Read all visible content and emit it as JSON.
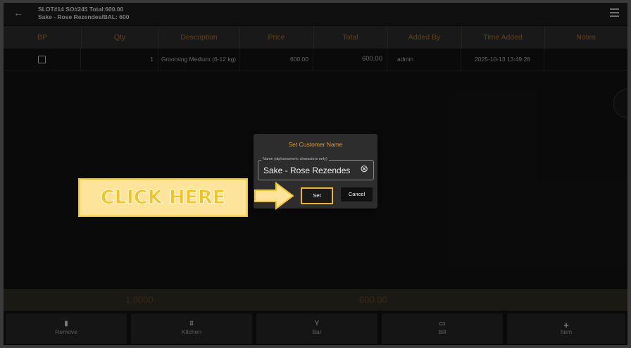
{
  "header": {
    "back_icon": "arrow-left-icon",
    "line1": "SLOT#14 SO#245 Total:600.00",
    "line2": "Sake - Rose Rezendes/BAL: 600",
    "menu_icon": "hamburger-menu-icon"
  },
  "table": {
    "columns": [
      "BP",
      "Qty",
      "Description",
      "Price",
      "Total",
      "Added By",
      "Time Added",
      "Notes"
    ],
    "rows": [
      {
        "bp_checked": false,
        "qty": "1",
        "description": "Grooming Medium (6-12 kg)",
        "price": "600.00",
        "total": "600.00",
        "added_by": "admin",
        "time_added": "2025-10-13 13:49:28",
        "notes": ""
      }
    ]
  },
  "totals": {
    "qty": "1.0000",
    "amount": "600.00"
  },
  "bottom_bar": [
    {
      "label": "Remove",
      "icon": "trash-icon"
    },
    {
      "label": "Kitchen",
      "icon": "chef-icon"
    },
    {
      "label": "Bar",
      "icon": "cocktail-icon"
    },
    {
      "label": "Bill",
      "icon": "receipt-icon"
    },
    {
      "label": "Item",
      "icon": "plus-icon"
    }
  ],
  "dialog": {
    "title": "Set Customer Name",
    "field_label": "Name (alphanumeric characters only)",
    "field_value": "Sake - Rose Rezendes",
    "clear_icon": "clear-circle-icon",
    "set_label": "Set",
    "cancel_label": "Cancel"
  },
  "callout": {
    "text": "CLICK HERE"
  },
  "colors": {
    "accent": "#e8971f",
    "highlight": "#f2b51e",
    "callout_bg": "#fde49a"
  }
}
